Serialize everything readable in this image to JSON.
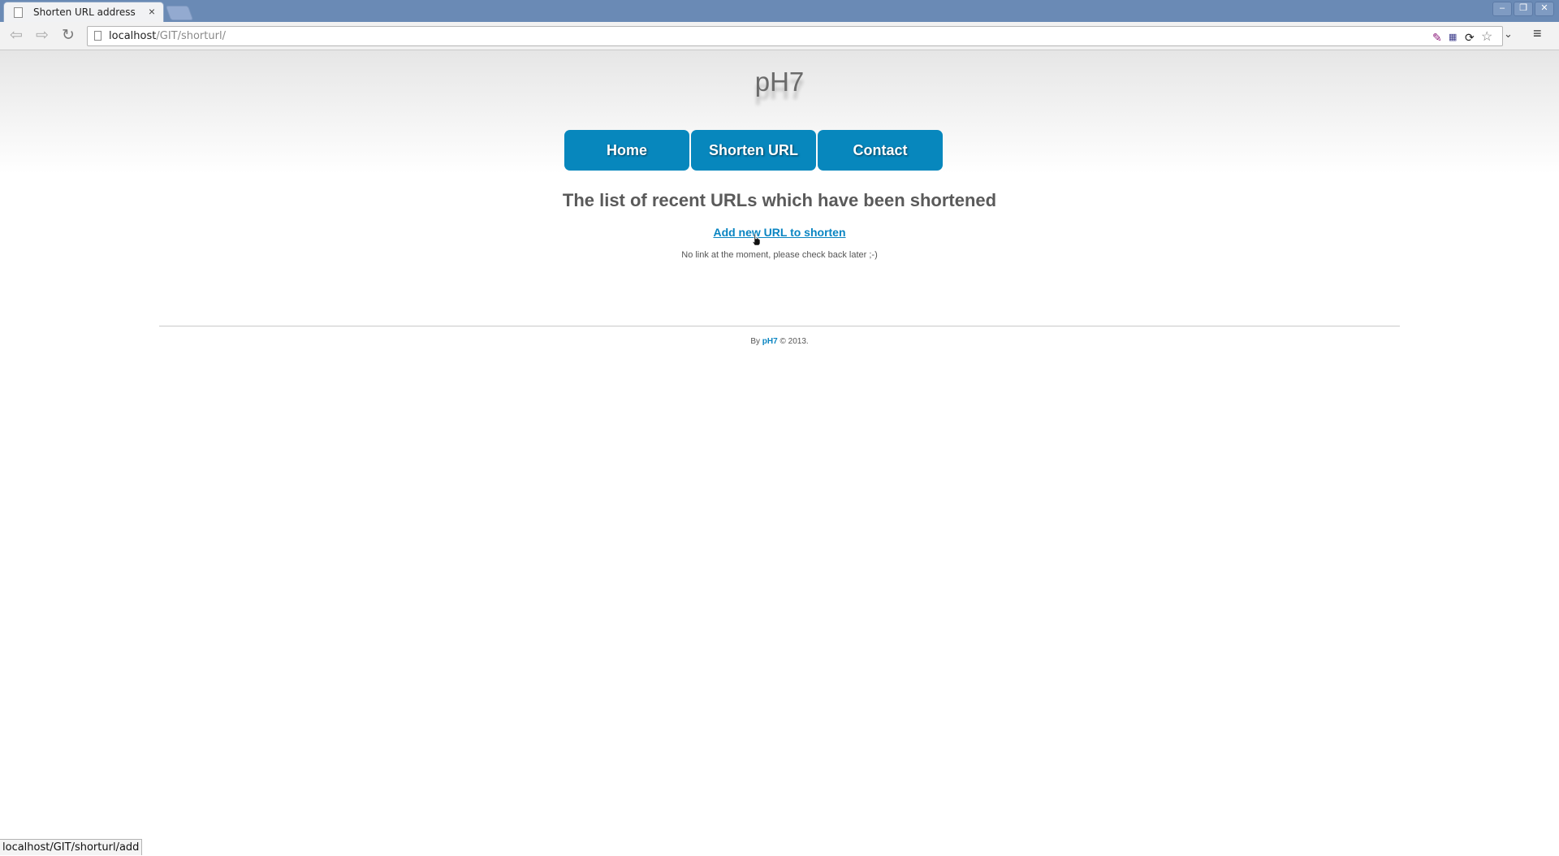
{
  "browser": {
    "tab_title": "Shorten URL address",
    "tab_close": "×",
    "url_host": "localhost",
    "url_path": "/GIT/shorturl/",
    "status_text": "localhost/GIT/shorturl/add",
    "window_buttons": [
      "–",
      "❐",
      "✕"
    ]
  },
  "header": {
    "logo": "pH7"
  },
  "nav": {
    "items": [
      {
        "label": "Home"
      },
      {
        "label": "Shorten URL"
      },
      {
        "label": "Contact"
      }
    ]
  },
  "main": {
    "heading": "The list of recent URLs which have been shortened",
    "add_link": "Add new URL to shorten",
    "empty_message": "No link at the moment, please check back later ;-)"
  },
  "footer": {
    "prefix": "By",
    "brand": "pH7",
    "suffix": "© 2013."
  },
  "colors": {
    "accent": "#0787bd",
    "link": "#0a85c2"
  }
}
